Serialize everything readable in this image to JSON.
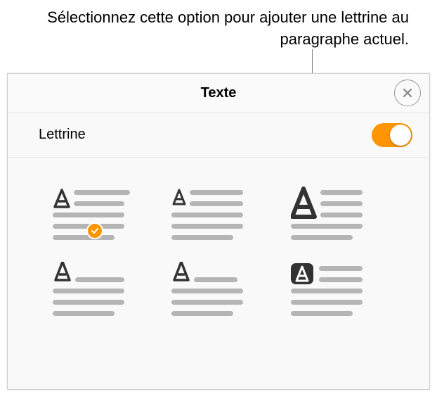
{
  "annotation": "Sélectionnez cette option pour ajouter une lettrine au paragraphe actuel.",
  "panel": {
    "title": "Texte",
    "setting_label": "Lettrine",
    "toggle_on": true,
    "close_icon": "close",
    "options": [
      {
        "id": "dropcap-style-1",
        "selected": true
      },
      {
        "id": "dropcap-style-2",
        "selected": false
      },
      {
        "id": "dropcap-style-3",
        "selected": false
      },
      {
        "id": "dropcap-style-4",
        "selected": false
      },
      {
        "id": "dropcap-style-5",
        "selected": false
      },
      {
        "id": "dropcap-style-6",
        "selected": false
      }
    ]
  }
}
